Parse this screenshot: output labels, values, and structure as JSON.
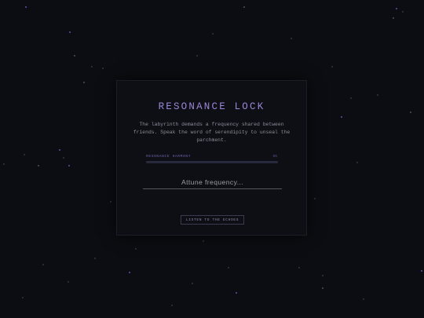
{
  "lock": {
    "title": "RESONANCE LOCK",
    "description": "The labyrinth demands a frequency shared between friends. Speak the word of serendipity to unseal the parchment.",
    "meter": {
      "label": "RESONANCE HARMONY",
      "value": "0%",
      "level": 0
    },
    "input": {
      "placeholder": "Attune frequency...",
      "value": ""
    },
    "button_label": "LISTEN TO THE ECHOES"
  },
  "colors": {
    "background": "#0c0d12",
    "panel": "#0e0f14",
    "accent": "#9a86d8",
    "meter_track": "#262a3c"
  }
}
